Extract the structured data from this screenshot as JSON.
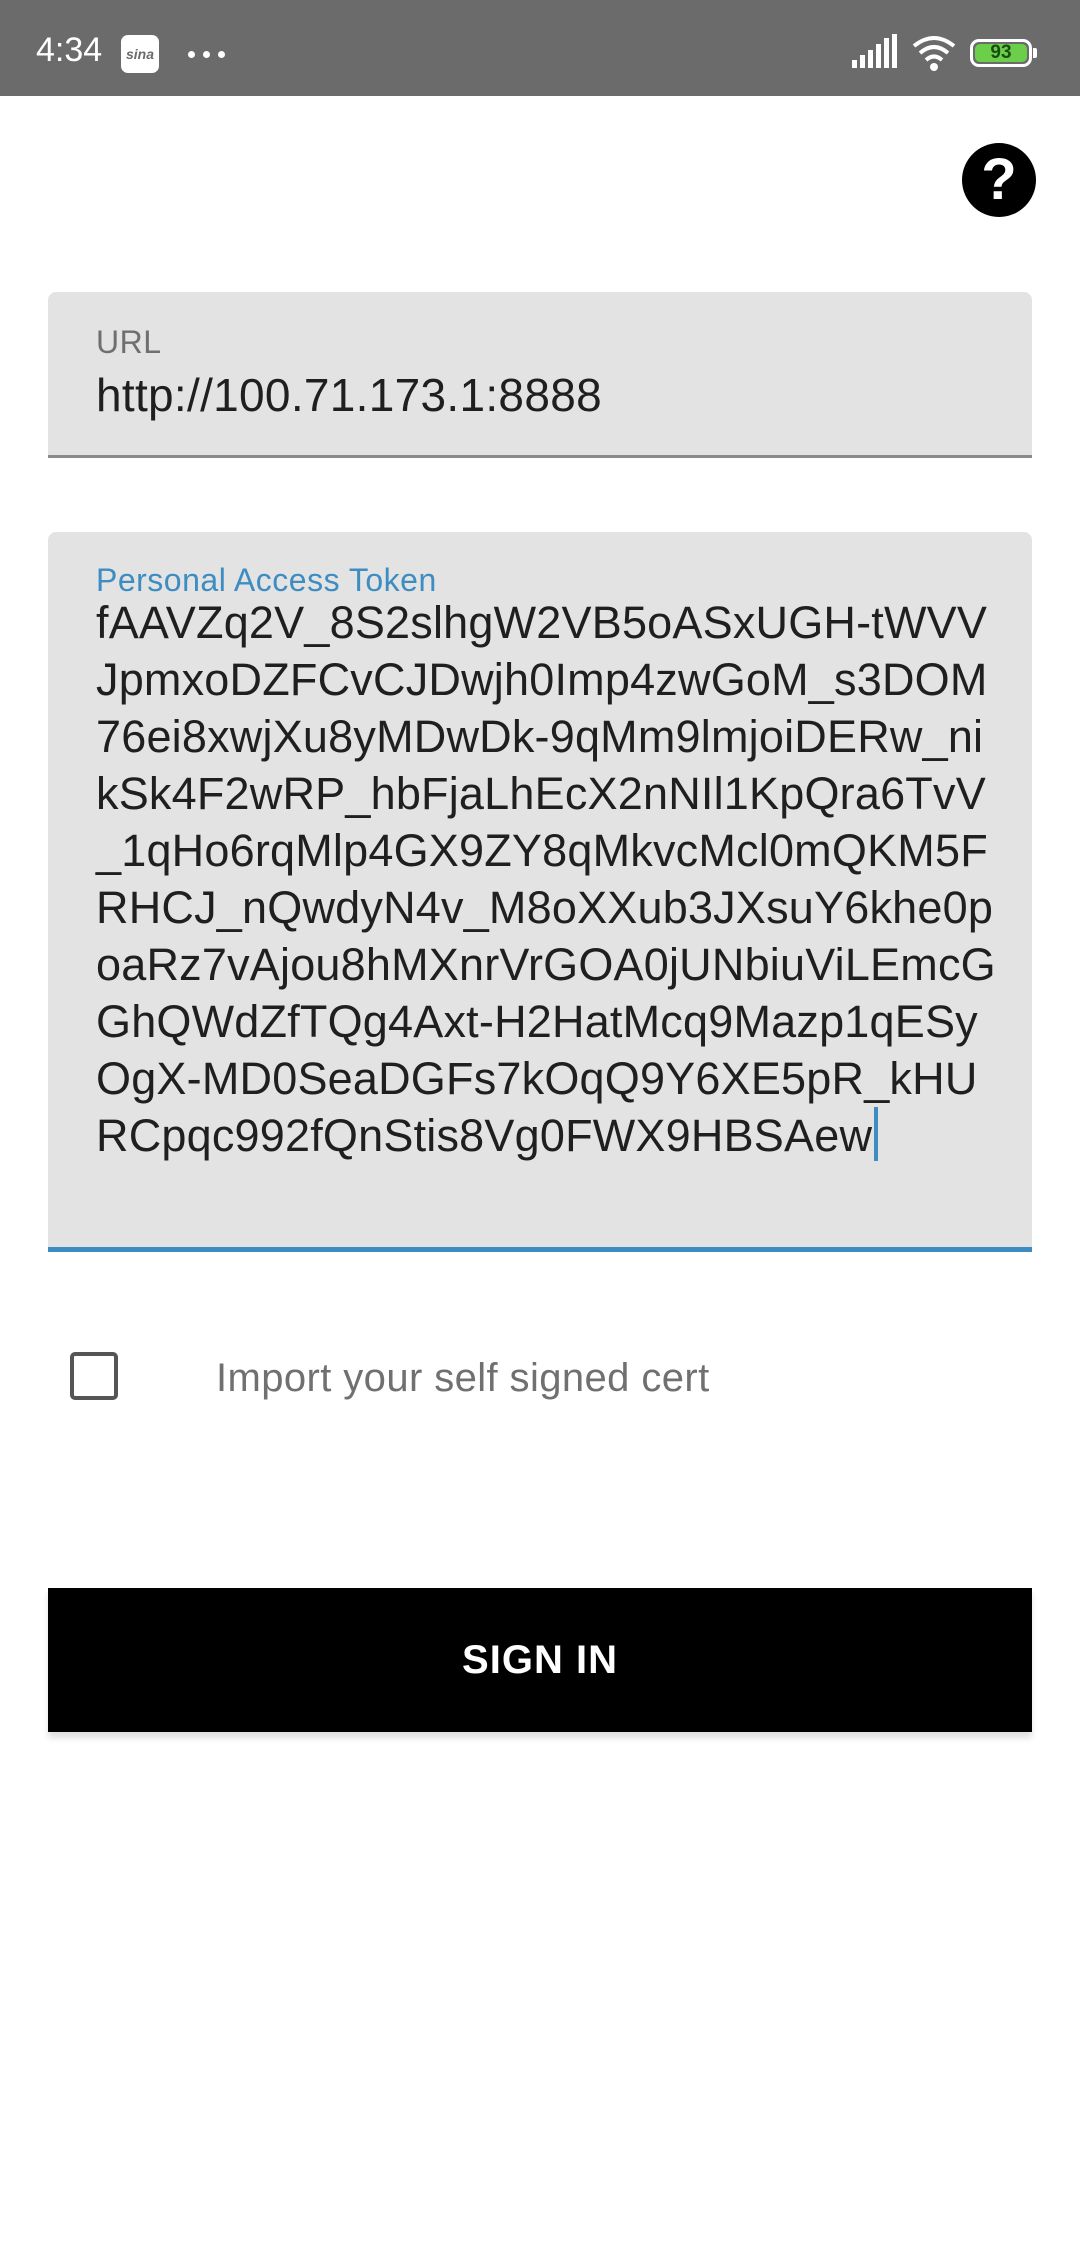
{
  "status_bar": {
    "time": "4:34",
    "app_badge": "sina",
    "battery": "93"
  },
  "form": {
    "url_label": "URL",
    "url_value": "http://100.71.173.1:8888",
    "token_label": "Personal Access Token",
    "token_value": "fAAVZq2V_8S2slhgW2VB5oASxUGH-tWVVJpmxoDZFCvCJDwjh0Imp4zwGoM_s3DOM76ei8xwjXu8yMDwDk-9qMm9lmjoiDERw_nikSk4F2wRP_hbFjaLhEcX2nNIl1KpQra6TvV_1qHo6rqMlp4GX9ZY8qMkvcMcl0mQKM5FRHCJ_nQwdyN4v_M8oXXub3JXsuY6khe0poaRz7vAjou8hMXnrVrGOA0jUNbiuViLEmcGGhQWdZfTQg4Axt-H2HatMcq9Mazp1qESyOgX-MD0SeaDGFs7kOqQ9Y6XE5pR_kHURCpqc992fQnStis8Vg0FWX9HBSAew",
    "self_signed_label": "Import your self signed cert",
    "self_signed_checked": false,
    "sign_in_label": "SIGN IN"
  },
  "icons": {
    "help": "help-circle-icon",
    "signal": "signal-icon",
    "wifi": "wifi-icon",
    "battery": "battery-icon"
  },
  "colors": {
    "status_bar": "#6b6b6b",
    "field_bg": "#e3e3e3",
    "accent": "#3d8cc2",
    "button": "#000000"
  }
}
